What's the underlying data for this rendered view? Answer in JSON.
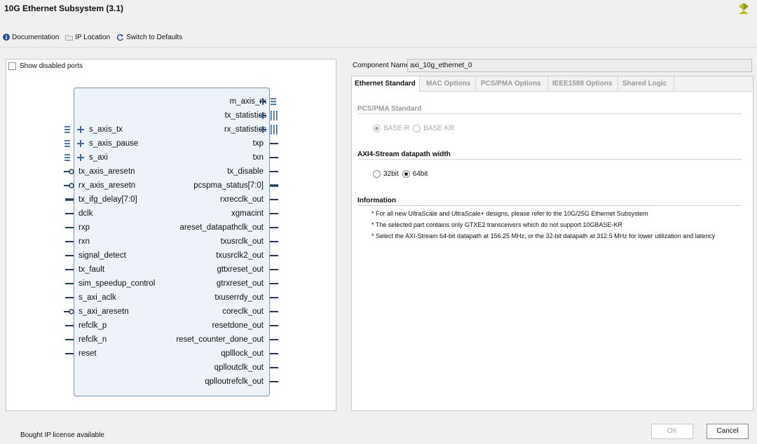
{
  "window": {
    "title": "10G Ethernet Subsystem (3.1)"
  },
  "toolbar": {
    "documentation": "Documentation",
    "ip_location": "IP Location",
    "switch_defaults": "Switch to Defaults"
  },
  "left_panel": {
    "show_disabled_ports": "Show disabled ports"
  },
  "ports": {
    "left": [
      "s_axis_tx",
      "s_axis_pause",
      "s_axi",
      "tx_axis_aresetn",
      "rx_axis_aresetn",
      "tx_ifg_delay[7:0]",
      "dclk",
      "rxp",
      "rxn",
      "signal_detect",
      "tx_fault",
      "sim_speedup_control",
      "s_axi_aclk",
      "s_axi_aresetn",
      "refclk_p",
      "refclk_n",
      "reset"
    ],
    "right": [
      "m_axis_rx",
      "tx_statistics",
      "rx_statistics",
      "txp",
      "txn",
      "tx_disable",
      "pcspma_status[7:0]",
      "rxrecclk_out",
      "xgmacint",
      "areset_datapathclk_out",
      "txusrclk_out",
      "txusrclk2_out",
      "gttxreset_out",
      "gtrxreset_out",
      "txuserrdy_out",
      "coreclk_out",
      "resetdone_out",
      "reset_counter_done_out",
      "qplllock_out",
      "qplloutclk_out",
      "qplloutrefclk_out"
    ]
  },
  "config": {
    "component_name_label": "Component Name",
    "component_name_value": "axi_10g_ethernet_0",
    "tabs": [
      "Ethernet Standard",
      "MAC Options",
      "PCS/PMA Options",
      "IEEE1588 Options",
      "Shared Logic"
    ],
    "pcs_pma": {
      "title": "PCS/PMA Standard",
      "options": [
        "BASE-R",
        "BASE-KR"
      ],
      "selected": "BASE-R"
    },
    "axi_stream": {
      "title": "AXI4-Stream datapath width",
      "options": [
        "32bit",
        "64bit"
      ],
      "selected": "64bit"
    },
    "information": {
      "title": "Information",
      "lines": [
        "* For all new UltraScale and UltraScale+ designs, please refer to the 10G/25G Ethernet Subsystem",
        "* The selected part contains only GTXE2 transceivers which do not support 10GBASE-KR",
        "* Select the AXI-Stream 64-bit datapath at 156.25 MHz, or the 32-bit datapath at 312.5 MHz for lower utilization and latency"
      ]
    }
  },
  "footer": {
    "status": "Bought IP license available",
    "ok_label": "OK",
    "cancel_label": "Cancel"
  },
  "colors": {
    "accent": "#1f4e9e",
    "logo": "#b6bf1e",
    "block_fill": "#eef3f9",
    "block_border": "#7b95b5"
  },
  "icons": {
    "documentation": "info-icon",
    "ip_location": "folder-icon",
    "switch_defaults": "refresh-icon",
    "logo": "vendor-logo-icon"
  }
}
